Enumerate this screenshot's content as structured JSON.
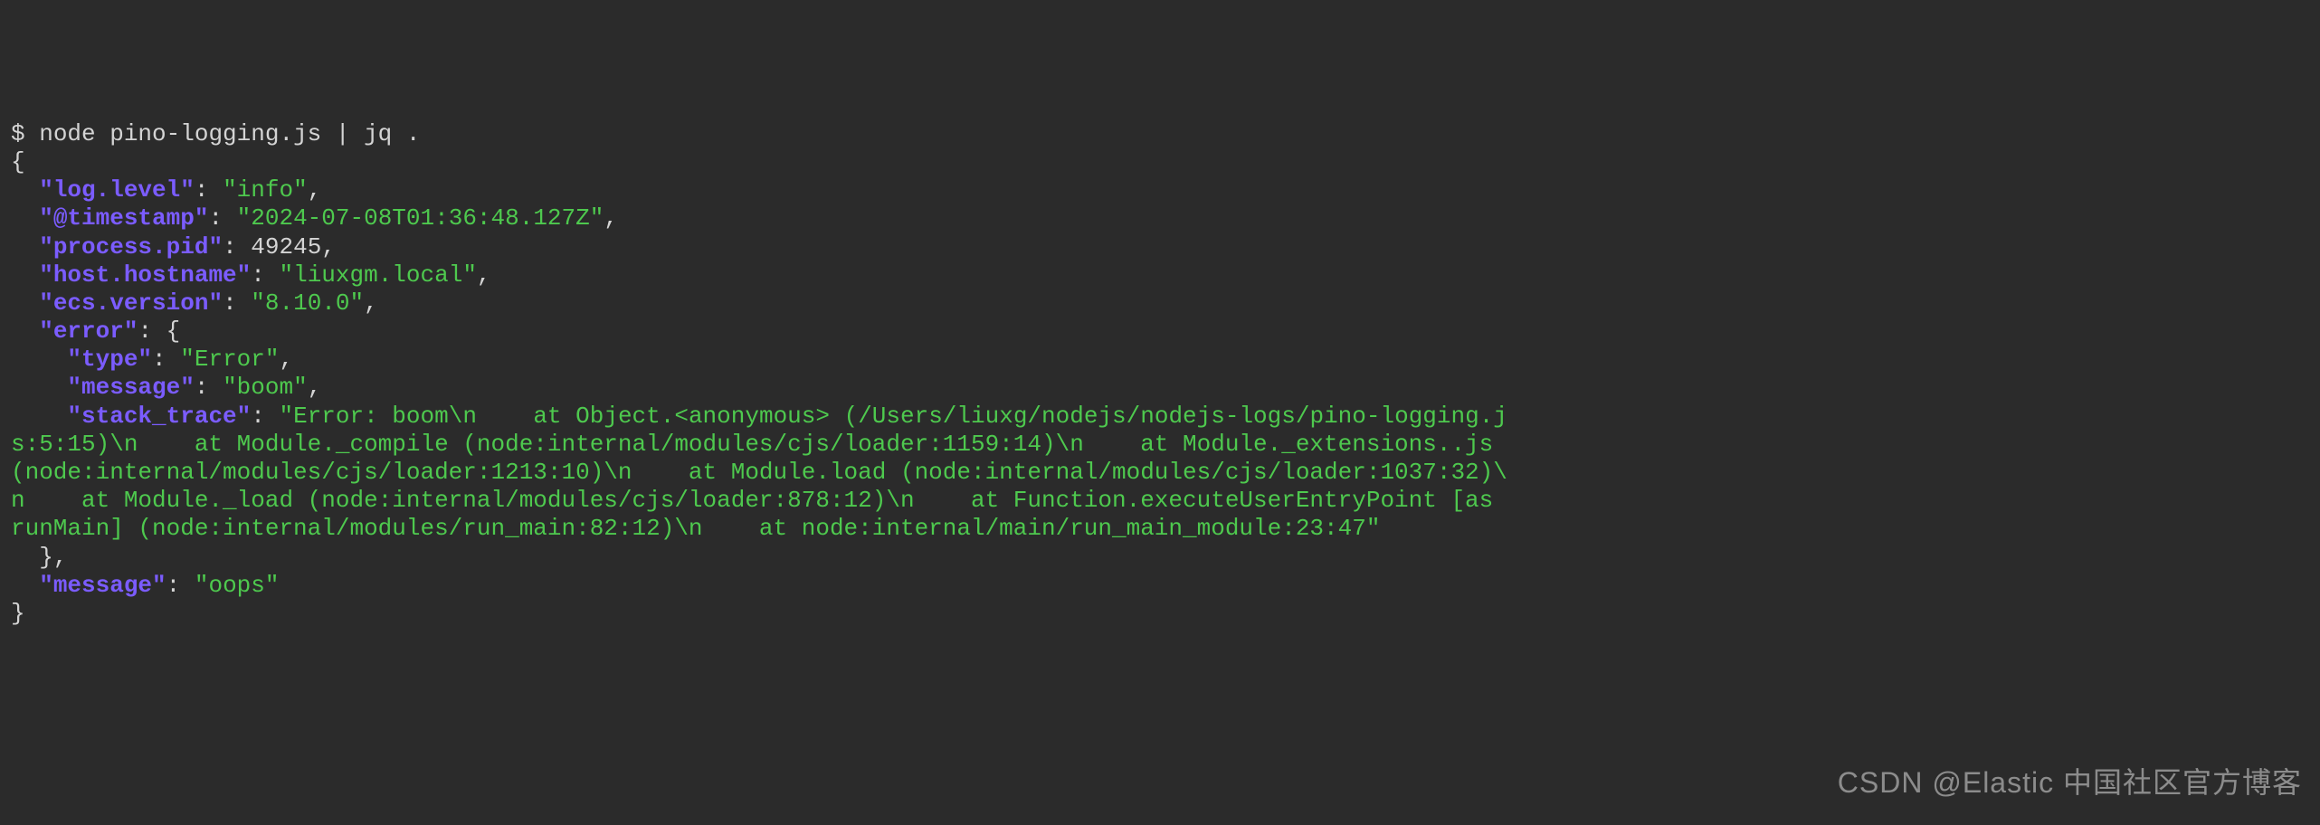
{
  "terminal": {
    "prompt": "$ ",
    "command": "node pino-logging.js | jq ."
  },
  "json_output": {
    "keys": {
      "log_level": "\"log.level\"",
      "timestamp": "\"@timestamp\"",
      "process_pid": "\"process.pid\"",
      "host_hostname": "\"host.hostname\"",
      "ecs_version": "\"ecs.version\"",
      "error": "\"error\"",
      "error_type": "\"type\"",
      "error_message": "\"message\"",
      "error_stack_trace": "\"stack_trace\"",
      "message": "\"message\""
    },
    "values": {
      "log_level": "\"info\"",
      "timestamp": "\"2024-07-08T01:36:48.127Z\"",
      "process_pid": "49245",
      "host_hostname": "\"liuxgm.local\"",
      "ecs_version": "\"8.10.0\"",
      "error_type": "\"Error\"",
      "error_message": "\"boom\"",
      "error_stack_trace": "\"Error: boom\\n    at Object.<anonymous> (/Users/liuxg/nodejs/nodejs-logs/pino-logging.js:5:15)\\n    at Module._compile (node:internal/modules/cjs/loader:1159:14)\\n    at Module._extensions..js (node:internal/modules/cjs/loader:1213:10)\\n    at Module.load (node:internal/modules/cjs/loader:1037:32)\\n    at Module._load (node:internal/modules/cjs/loader:878:12)\\n    at Function.executeUserEntryPoint [as runMain] (node:internal/modules/run_main:82:12)\\n    at node:internal/main/run_main_module:23:47\"",
      "message": "\"oops\""
    }
  },
  "watermark": "CSDN @Elastic 中国社区官方博客"
}
